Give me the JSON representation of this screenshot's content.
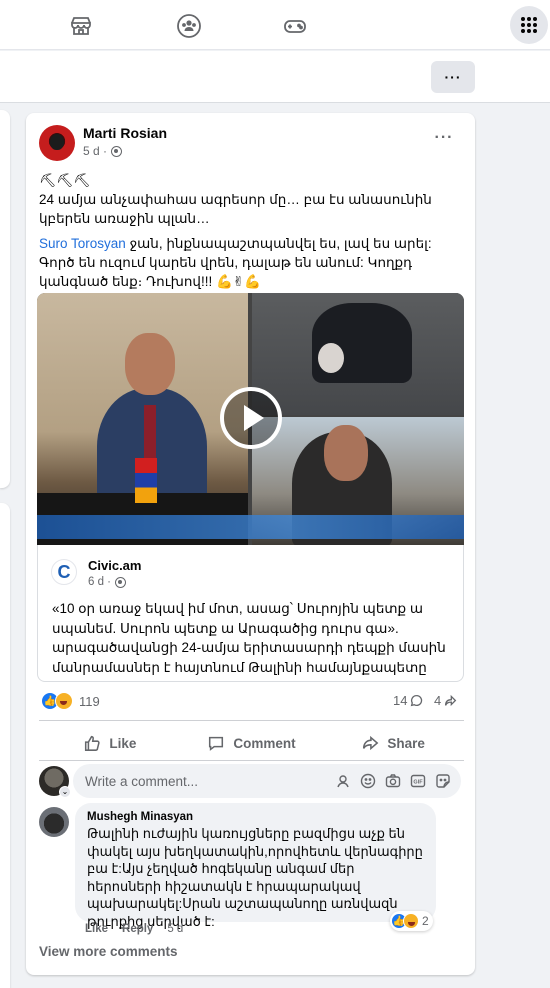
{
  "colors": {
    "accent": "#1877f2",
    "link": "#216fdb",
    "muted": "#65676b",
    "background": "#f0f2f5"
  },
  "nav": {
    "icons": [
      "marketplace-icon",
      "groups-icon",
      "gaming-icon"
    ],
    "menu_icon": "grid-menu-icon"
  },
  "subbar": {
    "more_label": "···"
  },
  "post": {
    "author": "Marti Rosian",
    "time": "5 d ·",
    "more_label": "···",
    "emoji_line": "⛏⛏⛏",
    "line1": "24 ամյա անչափահաս ագրեսոր մը… բա էս անասունին կբերեն առաջին պլան…",
    "mention": "Suro Torosyan",
    "line2": " ջան, ինքնապաշտպանվել ես, լավ ես արել: Գործ են ուզում կարեն վրեն, դալաթ են անում: Կողքդ կանգնած ենք։ Դուխով!!! 💪✌💪",
    "link": {
      "source": "Civic.am",
      "time": "6 d ·",
      "text": "«10 օր առաջ եկավ իմ մոտ, ասաց՝ Սուրոյին պետք ա սպանեմ. Սուրոն պետք ա Արագածից դուրս գա». արագածավանցի 24-ամյա երիտասարդի դեպքի մասին մանրամասներ է հայտնում Թալինի համայնքապետը"
    },
    "reaction_count": "119",
    "comment_count": "14",
    "share_count": "4",
    "actions": {
      "like": "Like",
      "comment": "Comment",
      "share": "Share"
    }
  },
  "comment_box": {
    "placeholder": "Write a comment...",
    "badge": "⌄"
  },
  "comment": {
    "author": "Mushegh Minasyan",
    "text": "Թալինի ուժային կառույցները բազմիցս աչք են փակել այս խեղկատակին,որովհետև վերնագիրը բա է:Այս չեղված հոգեկանը անգամ մեր հերոսների հիշատակն է հրապարակավ պախարակել:Սրան աշտապանողը առնվազն թուրքից սերված է:",
    "reaction_count": "2",
    "like_label": "Like",
    "reply_label": "Reply",
    "time": "5 d"
  },
  "view_more": "View more comments"
}
